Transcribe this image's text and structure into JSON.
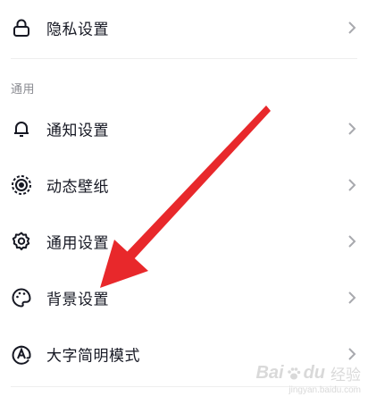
{
  "items_top": [
    {
      "label": "隐私设置",
      "icon": "lock-icon"
    }
  ],
  "section": {
    "title": "通用"
  },
  "items": [
    {
      "label": "通知设置",
      "icon": "bell-icon"
    },
    {
      "label": "动态壁纸",
      "icon": "live-wallpaper-icon"
    },
    {
      "label": "通用设置",
      "icon": "gear-icon"
    },
    {
      "label": "背景设置",
      "icon": "palette-icon"
    },
    {
      "label": "大字简明模式",
      "icon": "large-text-icon"
    }
  ],
  "annotation": {
    "arrow_color": "#e8282b"
  },
  "watermark": {
    "brand": "Bai",
    "brand_tail": "du",
    "suffix": "经验",
    "url": "jingyan.baidu.com"
  },
  "colors": {
    "text": "#161823",
    "muted": "#8a8b91",
    "divider": "#eeeeee",
    "chevron": "#a8a9ae"
  }
}
